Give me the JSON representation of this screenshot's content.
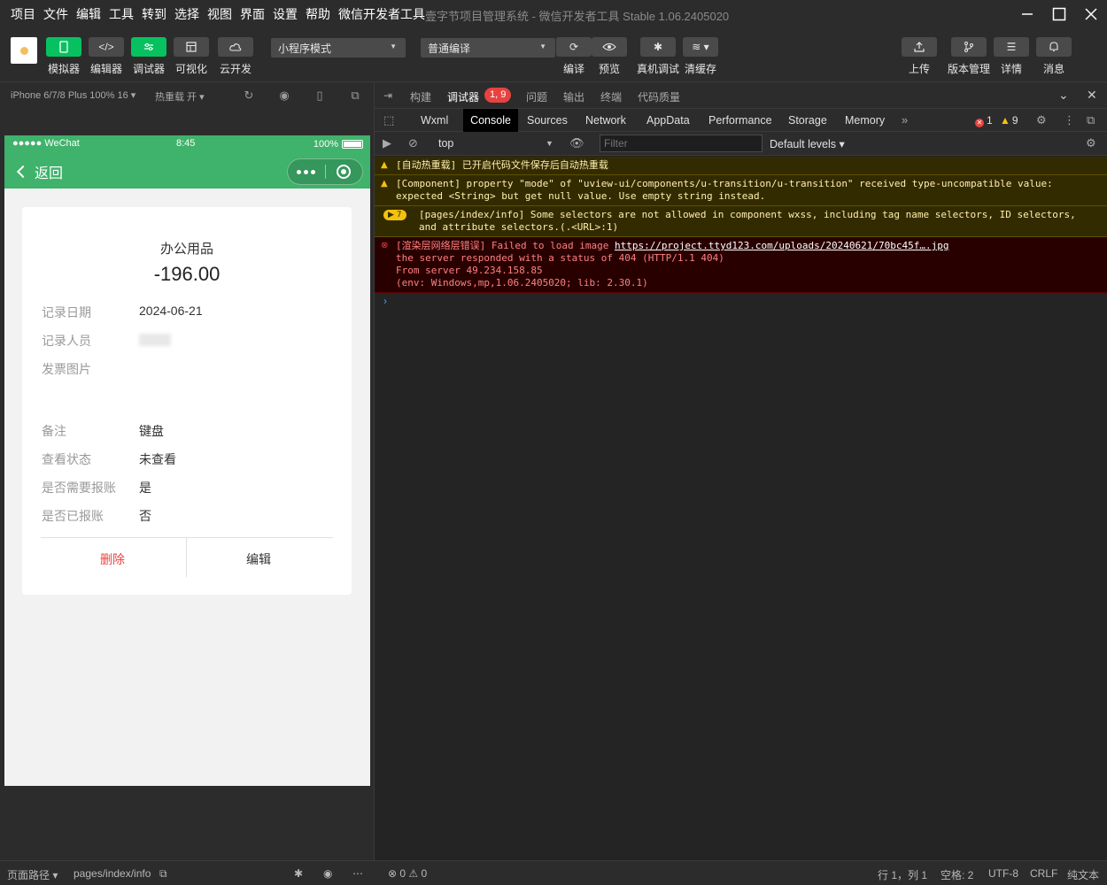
{
  "menubar": {
    "items": [
      "项目",
      "文件",
      "编辑",
      "工具",
      "转到",
      "选择",
      "视图",
      "界面",
      "设置",
      "帮助",
      "微信开发者工具"
    ],
    "title": "壹字节项目管理系统 - 微信开发者工具 Stable 1.06.2405020"
  },
  "toolbar": {
    "simulator": "模拟器",
    "editor": "编辑器",
    "debugger": "调试器",
    "visual": "可视化",
    "cloud": "云开发",
    "mode_select": "小程序模式",
    "compile_select": "普通编译",
    "compile": "编译",
    "preview": "预览",
    "real_debug": "真机调试",
    "clear_cache": "清缓存",
    "upload": "上传",
    "version": "版本管理",
    "details": "详情",
    "messages": "消息"
  },
  "simulator": {
    "device": "iPhone 6/7/8 Plus 100% 16 ▾",
    "hot_reload": "热重载 开 ▾"
  },
  "phone": {
    "carrier": "●●●●● WeChat",
    "time": "8:45",
    "battery": "100%",
    "back_label": "返回",
    "card": {
      "title": "办公用品",
      "amount": "-196.00",
      "fields": [
        {
          "label": "记录日期",
          "value": "2024-06-21"
        },
        {
          "label": "记录人员",
          "value": ""
        },
        {
          "label": "发票图片",
          "value": ""
        },
        {
          "label": "备注",
          "value": "键盘"
        },
        {
          "label": "查看状态",
          "value": "未查看"
        },
        {
          "label": "是否需要报账",
          "value": "是"
        },
        {
          "label": "是否已报账",
          "value": "否"
        }
      ],
      "delete_label": "删除",
      "edit_label": "编辑"
    }
  },
  "devtools": {
    "tabs": [
      "构建",
      "调试器",
      "问题",
      "输出",
      "终端",
      "代码质量"
    ],
    "badge": "1, 9",
    "console_tabs": [
      "Wxml",
      "Console",
      "Sources",
      "Network",
      "AppData",
      "Performance",
      "Storage",
      "Memory"
    ],
    "error_count": "1",
    "warning_count": "9",
    "context": "top",
    "filter_placeholder": "Filter",
    "levels": "Default levels ▾",
    "messages": [
      {
        "type": "warn",
        "lines": [
          "[自动热重载] 已开启代码文件保存后自动热重载"
        ]
      },
      {
        "type": "warn",
        "lines": [
          "[Component] property \"mode\" of \"uview-ui/components/u-transition/u-transition\" received type-uncompatible value:",
          "expected <String> but get null value. Use empty string instead."
        ]
      },
      {
        "type": "warn",
        "count": "7",
        "lines": [
          "[pages/index/info] Some selectors are not allowed in component wxss, including tag name selectors, ID selectors,",
          "and attribute selectors.(.<URL>:1)"
        ]
      },
      {
        "type": "err",
        "prefix": "[渲染层网络层错误] Failed to load image ",
        "link": "https://project.ttyd123.com/uploads/20240621/70bc45f….jpg",
        "lines": [
          "the server responded with a status of 404 (HTTP/1.1 404)",
          "From server 49.234.158.85",
          "(env: Windows,mp,1.06.2405020; lib: 2.30.1)"
        ]
      }
    ]
  },
  "statusbar": {
    "page_path_label": "页面路径 ▾",
    "page_path": "pages/index/info",
    "errors": "⊗ 0 ⚠ 0",
    "cursor": "行 1，列 1",
    "spaces": "空格: 2",
    "encoding": "UTF-8",
    "eol": "CRLF",
    "language": "纯文本"
  },
  "colors": {
    "wechat_green": "#3fb26b",
    "accent_green": "#07c160",
    "error_red": "#e64340",
    "warning_yellow": "#f4c20d"
  }
}
